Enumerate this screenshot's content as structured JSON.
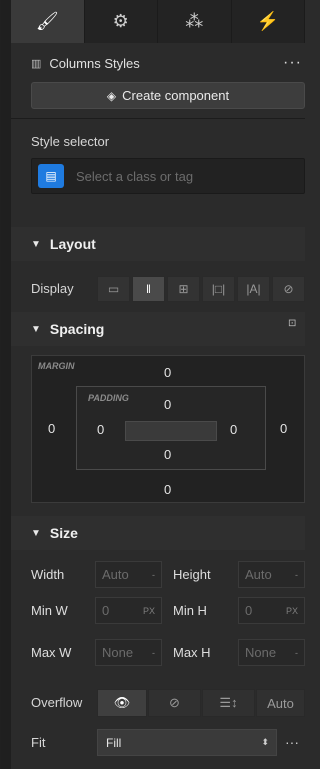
{
  "top_tabs": [
    {
      "name": "style-tab",
      "icon": "paintbrush-icon",
      "glyph": "🖌",
      "active": true
    },
    {
      "name": "settings-tab",
      "icon": "gear-icon",
      "glyph": "⚙",
      "active": false
    },
    {
      "name": "interactions-tab",
      "icon": "drops-icon",
      "glyph": "⁂",
      "active": false
    },
    {
      "name": "lightning-tab",
      "icon": "lightning-icon",
      "glyph": "⚡",
      "active": false
    }
  ],
  "header": {
    "title": "Columns Styles",
    "more": "···"
  },
  "create_component": {
    "label": "Create component"
  },
  "style_selector": {
    "label": "Style selector",
    "placeholder": "Select a class or tag"
  },
  "layout": {
    "title": "Layout",
    "display_label": "Display",
    "display_options": [
      {
        "name": "display-block",
        "glyph": "▭",
        "active": false
      },
      {
        "name": "display-flex",
        "glyph": "‖",
        "active": true
      },
      {
        "name": "display-grid",
        "glyph": "⊞",
        "active": false
      },
      {
        "name": "display-inline-block",
        "glyph": "|□|",
        "active": false
      },
      {
        "name": "display-inline",
        "glyph": "|A|",
        "active": false
      },
      {
        "name": "display-none",
        "glyph": "⊘",
        "active": false
      }
    ]
  },
  "spacing": {
    "title": "Spacing",
    "margin_label": "MARGIN",
    "padding_label": "PADDING",
    "margin": {
      "top": "0",
      "right": "0",
      "bottom": "0",
      "left": "0"
    },
    "padding": {
      "top": "0",
      "right": "0",
      "bottom": "0",
      "left": "0"
    }
  },
  "size": {
    "title": "Size",
    "width": {
      "label": "Width",
      "value": "Auto",
      "unit": "-"
    },
    "height": {
      "label": "Height",
      "value": "Auto",
      "unit": "-"
    },
    "min_w": {
      "label": "Min W",
      "value": "0",
      "unit": "PX"
    },
    "min_h": {
      "label": "Min H",
      "value": "0",
      "unit": "PX"
    },
    "max_w": {
      "label": "Max W",
      "value": "None",
      "unit": "-"
    },
    "max_h": {
      "label": "Max H",
      "value": "None",
      "unit": "-"
    },
    "overflow_label": "Overflow",
    "overflow_options": [
      {
        "name": "overflow-visible",
        "glyph": "👁",
        "active": true
      },
      {
        "name": "overflow-hidden",
        "glyph": "⊘",
        "active": false
      },
      {
        "name": "overflow-scroll",
        "glyph": "☰↕",
        "active": false
      },
      {
        "name": "overflow-auto",
        "glyph": "Auto",
        "active": false
      }
    ],
    "fit_label": "Fit",
    "fit_value": "Fill",
    "fit_more": "···"
  }
}
